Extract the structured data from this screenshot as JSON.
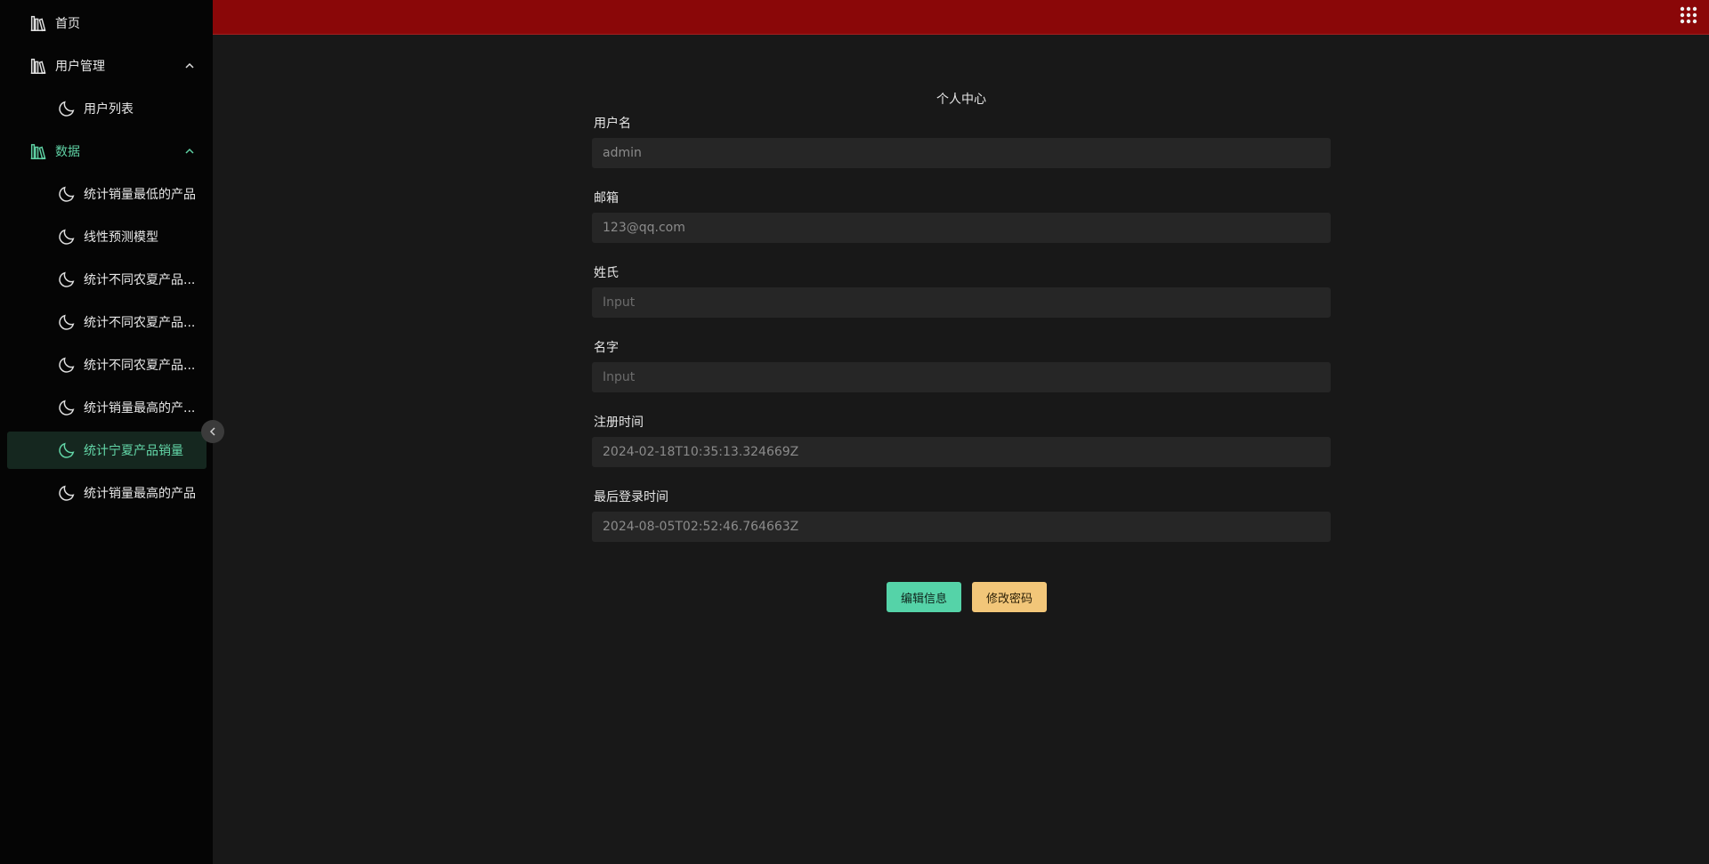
{
  "colors": {
    "topbar": "#8a0708",
    "sidebar": "#050505",
    "content": "#181818",
    "accent": "#5fd1a4",
    "edit_button": "#55d3a8",
    "password_button": "#f2c679"
  },
  "sidebar": {
    "items": [
      {
        "label": "首页",
        "icon": "library-icon"
      },
      {
        "label": "用户管理",
        "icon": "library-icon",
        "expanded": true
      },
      {
        "label": "用户列表",
        "icon": "moon-icon"
      },
      {
        "label": "数据",
        "icon": "library-icon",
        "expanded": true
      },
      {
        "label": "统计销量最低的产品",
        "icon": "moon-icon"
      },
      {
        "label": "线性预测模型",
        "icon": "moon-icon"
      },
      {
        "label": "统计不同农夏产品...",
        "icon": "moon-icon"
      },
      {
        "label": "统计不同农夏产品...",
        "icon": "moon-icon"
      },
      {
        "label": "统计不同农夏产品...",
        "icon": "moon-icon"
      },
      {
        "label": "统计销量最高的产...",
        "icon": "moon-icon"
      },
      {
        "label": "统计宁夏产品销量",
        "icon": "moon-icon",
        "selected": true
      },
      {
        "label": "统计销量最高的产品",
        "icon": "moon-icon"
      }
    ]
  },
  "main": {
    "title": "个人中心",
    "fields": [
      {
        "label": "用户名",
        "value": "admin",
        "placeholder": ""
      },
      {
        "label": "邮箱",
        "value": "123@qq.com",
        "placeholder": ""
      },
      {
        "label": "姓氏",
        "value": "",
        "placeholder": "Input"
      },
      {
        "label": "名字",
        "value": "",
        "placeholder": "Input"
      },
      {
        "label": "注册时间",
        "value": "2024-02-18T10:35:13.324669Z",
        "placeholder": ""
      },
      {
        "label": "最后登录时间",
        "value": "2024-08-05T02:52:46.764663Z",
        "placeholder": ""
      }
    ],
    "buttons": {
      "edit_label": "编辑信息",
      "password_label": "修改密码"
    }
  }
}
